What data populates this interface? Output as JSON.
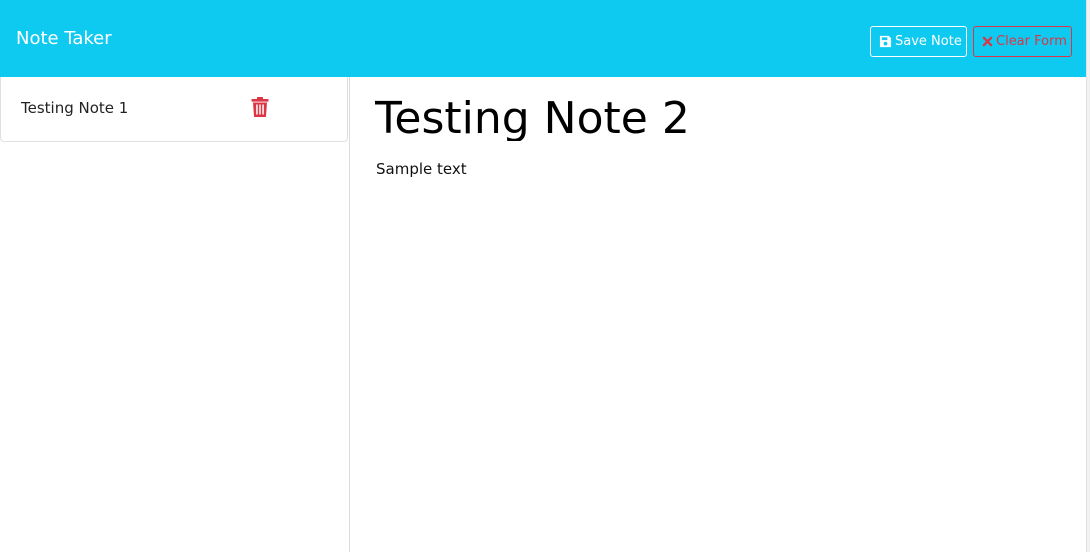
{
  "navbar": {
    "brand": "Note Taker",
    "save_label": "Save Note",
    "clear_label": "Clear Form",
    "colors": {
      "background": "#0fcaf0",
      "danger": "#dc3545"
    }
  },
  "sidebar": {
    "notes": [
      {
        "title": "Testing Note 1",
        "delete_icon": "trash-icon"
      }
    ]
  },
  "editor": {
    "title": "Testing Note 2",
    "text": "Sample text"
  }
}
